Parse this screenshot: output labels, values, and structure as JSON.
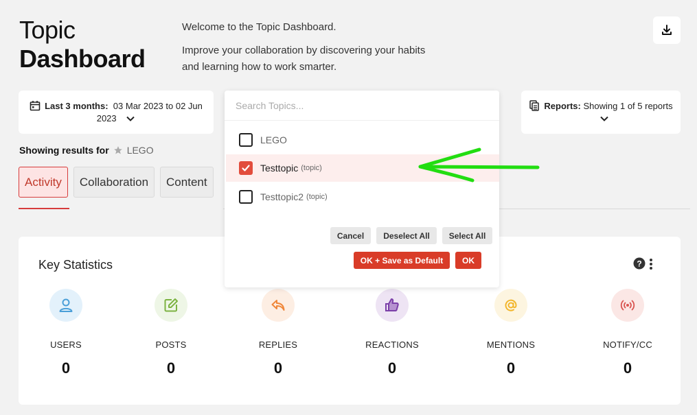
{
  "header": {
    "title_line1": "Topic",
    "title_line2": "Dashboard",
    "welcome_line1": "Welcome to the Topic Dashboard.",
    "welcome_line2": "Improve your collaboration by discovering your habits and learning how to work smarter.",
    "download_icon": "download-icon"
  },
  "date_filter": {
    "label": "Last 3 months:",
    "range": "03 Mar 2023 to 02 Jun 2023"
  },
  "search": {
    "placeholder": "Search Topics..."
  },
  "reports": {
    "label": "Reports:",
    "value": "Showing 1 of 5 reports"
  },
  "showing": {
    "label": "Showing results for",
    "topic": "LEGO"
  },
  "tabs": [
    {
      "label": "Activity",
      "active": true
    },
    {
      "label": "Collaboration",
      "active": false
    },
    {
      "label": "Content",
      "active": false
    }
  ],
  "dropdown": {
    "options": [
      {
        "label": "LEGO",
        "sub": "",
        "checked": false
      },
      {
        "label": "Testtopic",
        "sub": "(topic)",
        "checked": true
      },
      {
        "label": "Testtopic2",
        "sub": "(topic)",
        "checked": false
      }
    ],
    "cancel": "Cancel",
    "deselect_all": "Deselect All",
    "select_all": "Select All",
    "ok_save_default": "OK + Save as Default",
    "ok": "OK"
  },
  "key_statistics": {
    "title": "Key Statistics",
    "stats": [
      {
        "label": "USERS",
        "value": "0",
        "icon": "user-icon",
        "color": "#4a9fd8"
      },
      {
        "label": "POSTS",
        "value": "0",
        "icon": "edit-icon",
        "color": "#7cb342"
      },
      {
        "label": "REPLIES",
        "value": "0",
        "icon": "reply-icon",
        "color": "#f0873a"
      },
      {
        "label": "REACTIONS",
        "value": "0",
        "icon": "thumbs-up-icon",
        "color": "#7b3fa8"
      },
      {
        "label": "MENTIONS",
        "value": "0",
        "icon": "at-icon",
        "color": "#f2b62c"
      },
      {
        "label": "NOTIFY/CC",
        "value": "0",
        "icon": "broadcast-icon",
        "color": "#d9534f"
      }
    ]
  },
  "colors": {
    "accent_red": "#d93c28",
    "active_tab_bg": "#fde4e4",
    "annotation_arrow": "#22dd11"
  }
}
